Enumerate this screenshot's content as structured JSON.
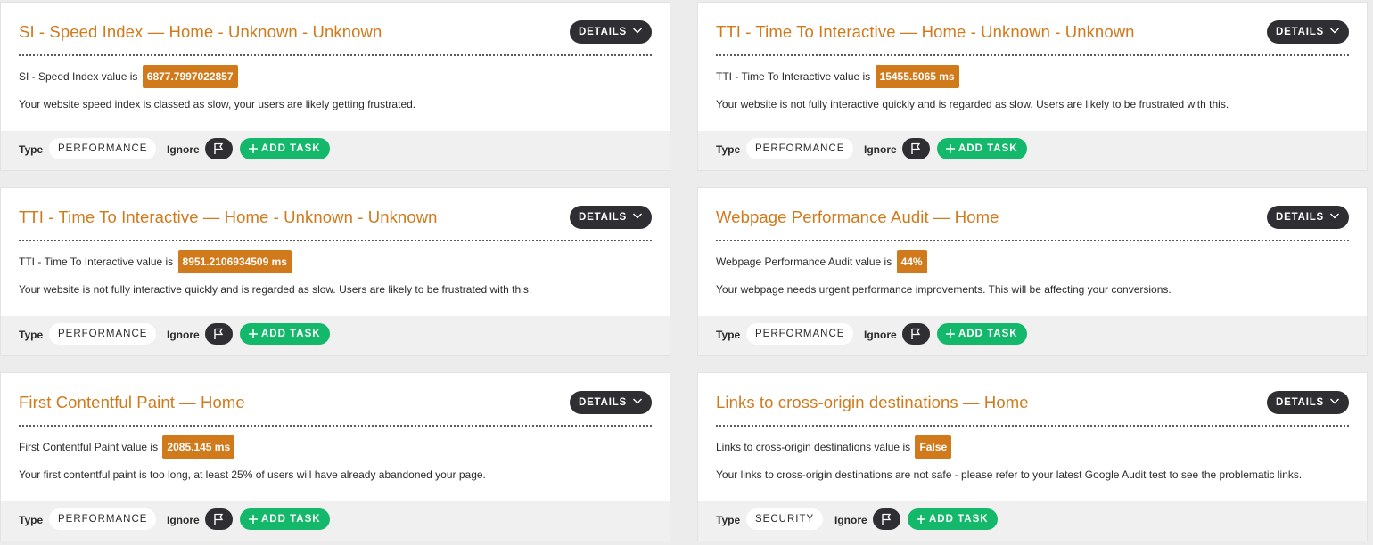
{
  "common": {
    "details_label": "DETAILS",
    "type_label": "Type",
    "ignore_label": "Ignore",
    "add_task_label": "ADD TASK"
  },
  "colors": {
    "accent_orange": "#d07a1c",
    "dark_button": "#2e2e33",
    "add_task_green": "#14b86a",
    "footer_bg": "#eff0ef"
  },
  "icons": {
    "details": "chevron-down-icon",
    "ignore": "flag-icon",
    "add_task": "plus-icon"
  },
  "cards": [
    {
      "title": "SI - Speed Index — Home - Unknown - Unknown",
      "value_label": "SI - Speed Index value is",
      "value": "6877.7997022857",
      "description": "Your website speed index is classed as slow, your users are likely getting frustrated.",
      "type": "PERFORMANCE"
    },
    {
      "title": "TTI - Time To Interactive — Home - Unknown - Unknown",
      "value_label": "TTI - Time To Interactive value is",
      "value": "15455.5065 ms",
      "description": "Your website is not fully interactive quickly and is regarded as slow. Users are likely to be frustrated with this.",
      "type": "PERFORMANCE"
    },
    {
      "title": "TTI - Time To Interactive — Home - Unknown - Unknown",
      "value_label": "TTI - Time To Interactive value is",
      "value": "8951.2106934509 ms",
      "description": "Your website is not fully interactive quickly and is regarded as slow. Users are likely to be frustrated with this.",
      "type": "PERFORMANCE"
    },
    {
      "title": "Webpage Performance Audit — Home",
      "value_label": "Webpage Performance Audit value is",
      "value": "44%",
      "description": "Your webpage needs urgent performance improvements. This will be affecting your conversions.",
      "type": "PERFORMANCE"
    },
    {
      "title": "First Contentful Paint — Home",
      "value_label": "First Contentful Paint value is",
      "value": "2085.145 ms",
      "description": "Your first contentful paint is too long, at least 25% of users will have already abandoned your page.",
      "type": "PERFORMANCE"
    },
    {
      "title": "Links to cross-origin destinations — Home",
      "value_label": "Links to cross-origin destinations value is",
      "value": "False",
      "description": "Your links to cross-origin destinations are not safe - please refer to your latest Google Audit test to see the problematic links.",
      "type": "SECURITY"
    }
  ]
}
